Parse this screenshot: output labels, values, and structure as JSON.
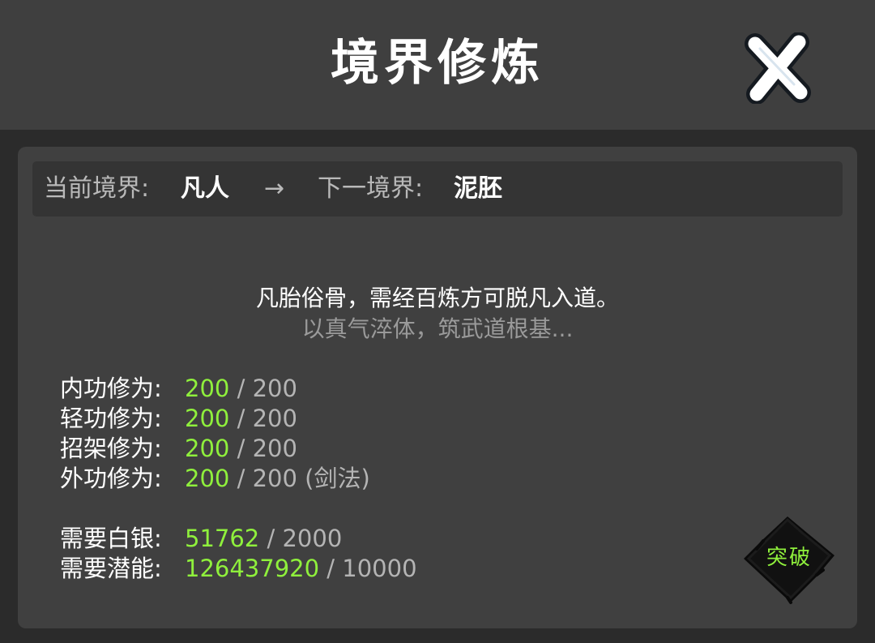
{
  "header": {
    "title": "境界修炼"
  },
  "realm": {
    "current_label": "当前境界:",
    "current_value": "凡人",
    "arrow": "→",
    "next_label": "下一境界:",
    "next_value": "泥胚"
  },
  "description": {
    "line1": "凡胎俗骨，需经百炼方可脱凡入道。",
    "line2": "以真气淬体，筑武道根基..."
  },
  "stats": [
    {
      "label": "内功修为:",
      "current": "200",
      "sep": " / ",
      "max": "200",
      "note": ""
    },
    {
      "label": "轻功修为:",
      "current": "200",
      "sep": " / ",
      "max": "200",
      "note": ""
    },
    {
      "label": "招架修为:",
      "current": "200",
      "sep": " / ",
      "max": "200",
      "note": ""
    },
    {
      "label": "外功修为:",
      "current": "200",
      "sep": " / ",
      "max": "200",
      "note": " (剑法)"
    }
  ],
  "costs": [
    {
      "label": "需要白银:",
      "current": "51762",
      "sep": " / ",
      "max": "2000"
    },
    {
      "label": "需要潜能:",
      "current": "126437920",
      "sep": " / ",
      "max": "10000"
    }
  ],
  "actions": {
    "breakthrough_label": "突破"
  },
  "colors": {
    "header_bg": "#3f3f3f",
    "page_bg": "#2b2b2b",
    "panel_bg": "#404040",
    "realm_bar_bg": "#343434",
    "accent_green": "#8ff03c",
    "muted_text": "#b4b4b4"
  },
  "icons": {
    "close": "close-x-icon",
    "breakthrough": "ink-diamond-icon"
  }
}
